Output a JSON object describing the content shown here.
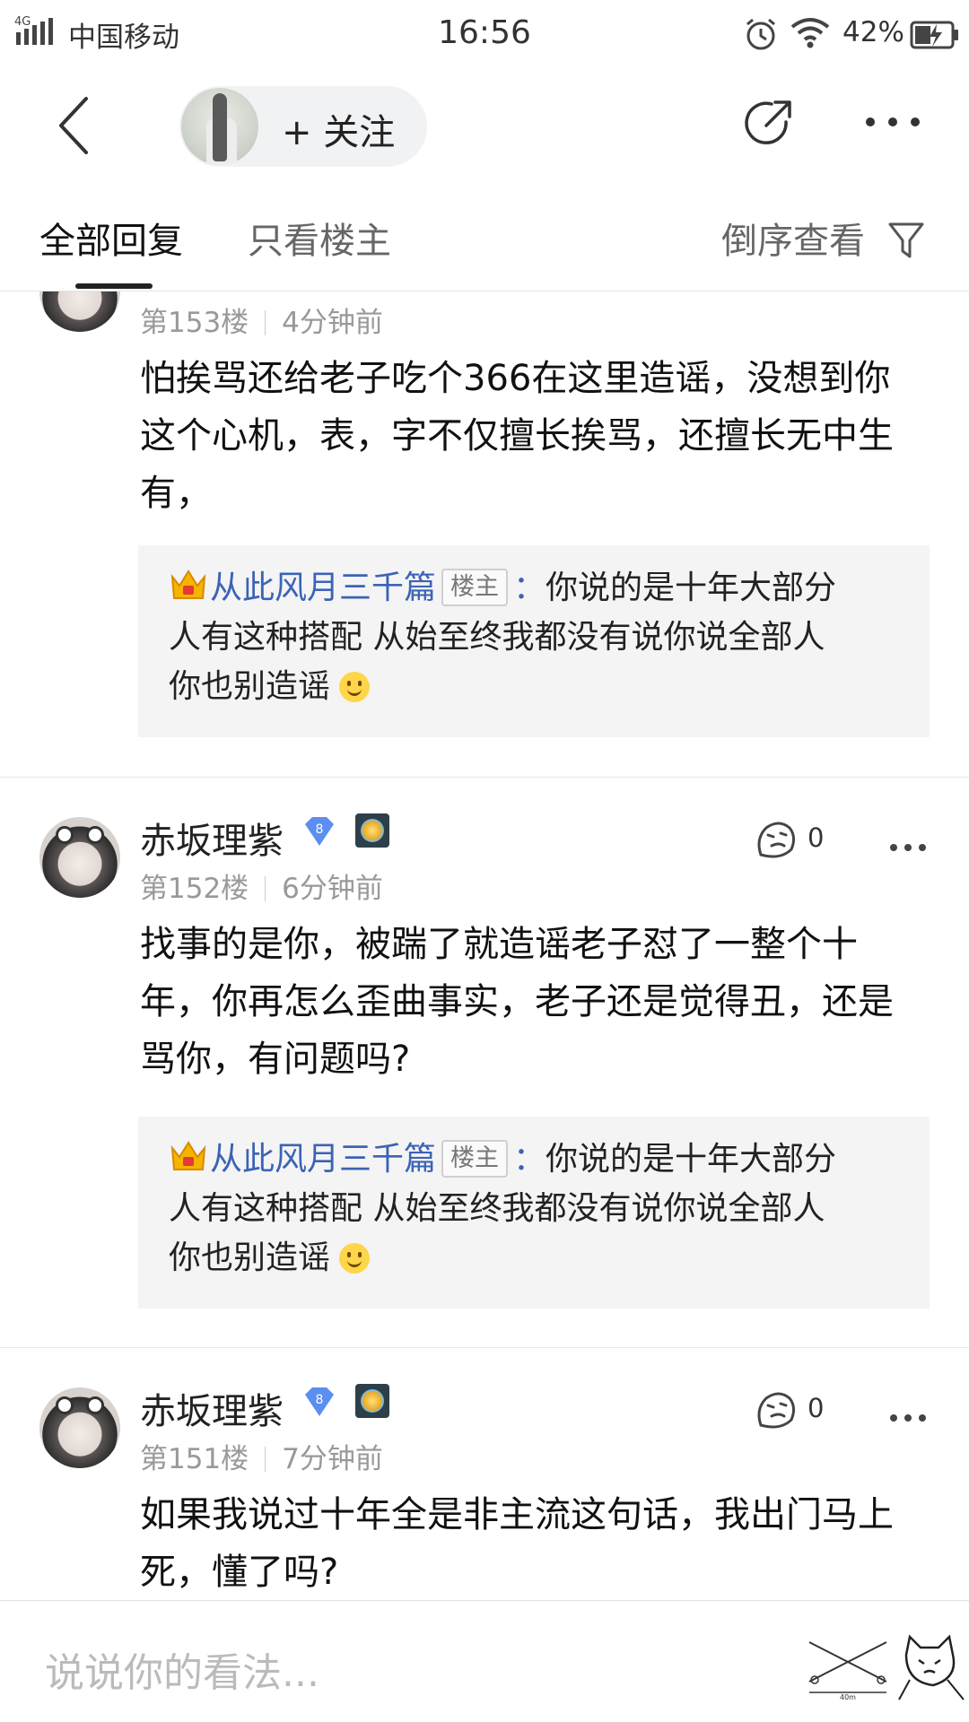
{
  "status_bar": {
    "network": "4G",
    "carrier": "中国移动",
    "time": "16:56",
    "battery": "42%"
  },
  "header": {
    "follow_label": "+ 关注"
  },
  "tabs": {
    "all_replies": "全部回复",
    "host_only": "只看楼主",
    "reverse_order": "倒序查看"
  },
  "colors": {
    "reply_name": "#3c63b5",
    "meta_gray": "#999999",
    "quote_bg": "#f4f4f4"
  },
  "posts": [
    {
      "floor": "第153楼",
      "time": "4分钟前",
      "lines": [
        "怕挨骂还给老子吃个366在这里造谣，没想到你",
        "这个心机，表，字不仅擅长挨骂，还擅长无中生",
        "有，"
      ],
      "reply": {
        "name": "从此风月三千篇",
        "tag": "楼主",
        "text1": "你说的是十年大部分",
        "text2": "人有这种搭配 从始至终我都没有说你说全部人",
        "text3": "你也别造谣"
      }
    },
    {
      "username": "赤坂理紫",
      "level": "8",
      "floor": "第152楼",
      "time": "6分钟前",
      "likes": "0",
      "lines": [
        "找事的是你，被踹了就造谣老子怼了一整个十",
        "年，你再怎么歪曲事实，老子还是觉得丑，还是",
        "骂你，有问题吗?"
      ],
      "reply": {
        "name": "从此风月三千篇",
        "tag": "楼主",
        "text1": "你说的是十年大部分",
        "text2": "人有这种搭配 从始至终我都没有说你说全部人",
        "text3": "你也别造谣"
      }
    },
    {
      "username": "赤坂理紫",
      "level": "8",
      "floor": "第151楼",
      "time": "7分钟前",
      "likes": "0",
      "lines": [
        "如果我说过十年全是非主流这句话，我出门马上",
        "死，懂了吗?"
      ]
    }
  ],
  "input": {
    "placeholder": "说说你的看法..."
  },
  "stickers": {
    "measure_label": "40m"
  }
}
